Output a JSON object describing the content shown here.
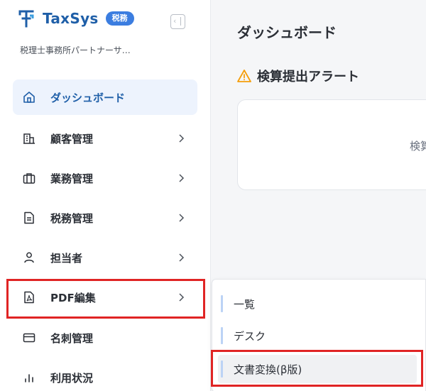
{
  "brand": {
    "name": "TaxSys",
    "badge": "税務",
    "accent": "#1f5fa8",
    "badge_color": "#3b7de0"
  },
  "org": {
    "name": "税理士事務所パートナーサ…"
  },
  "sidebar": {
    "items": [
      {
        "label": "ダッシュボード",
        "icon": "home-icon",
        "active": true
      },
      {
        "label": "顧客管理",
        "icon": "building-icon",
        "has_submenu": true
      },
      {
        "label": "業務管理",
        "icon": "briefcase-icon",
        "has_submenu": true
      },
      {
        "label": "税務管理",
        "icon": "document-icon",
        "has_submenu": true
      },
      {
        "label": "担当者",
        "icon": "user-icon",
        "has_submenu": true
      },
      {
        "label": "PDF編集",
        "icon": "pdf-file-icon",
        "has_submenu": true,
        "highlighted": true
      },
      {
        "label": "名刺管理",
        "icon": "card-icon"
      },
      {
        "label": "利用状況",
        "icon": "bar-chart-icon"
      }
    ]
  },
  "main": {
    "title": "ダッシュボード",
    "alert_heading": "検算提出アラート",
    "alert_card_text": "検算"
  },
  "submenu": {
    "parent": "PDF編集",
    "items": [
      {
        "label": "一覧"
      },
      {
        "label": "デスク"
      },
      {
        "label": "文書変換(β版)",
        "highlighted": true
      }
    ]
  },
  "colors": {
    "highlight": "#e02424",
    "warning": "#f59e0b",
    "active_bg": "#edf3fd"
  }
}
